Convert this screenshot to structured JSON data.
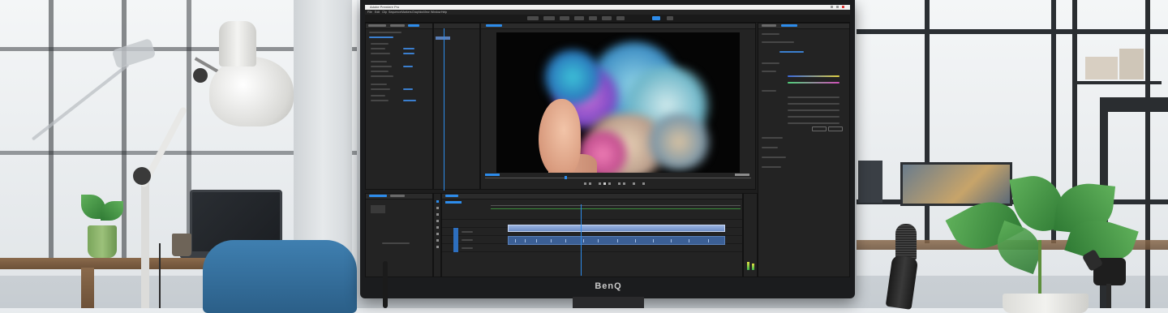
{
  "scene": {
    "monitor_brand": "BenQ",
    "app_title": "Adobe Premiere Pro",
    "accent_color": "#2d8ceb",
    "menu_items": [
      "File",
      "Edit",
      "Clip",
      "Sequence",
      "Markers",
      "Graphics",
      "View",
      "Window",
      "Help"
    ],
    "icons": [
      "desk-lamp-icon",
      "microphone-icon",
      "potted-plant-icon",
      "laptop-icon",
      "chair-icon",
      "camera-icon"
    ]
  }
}
